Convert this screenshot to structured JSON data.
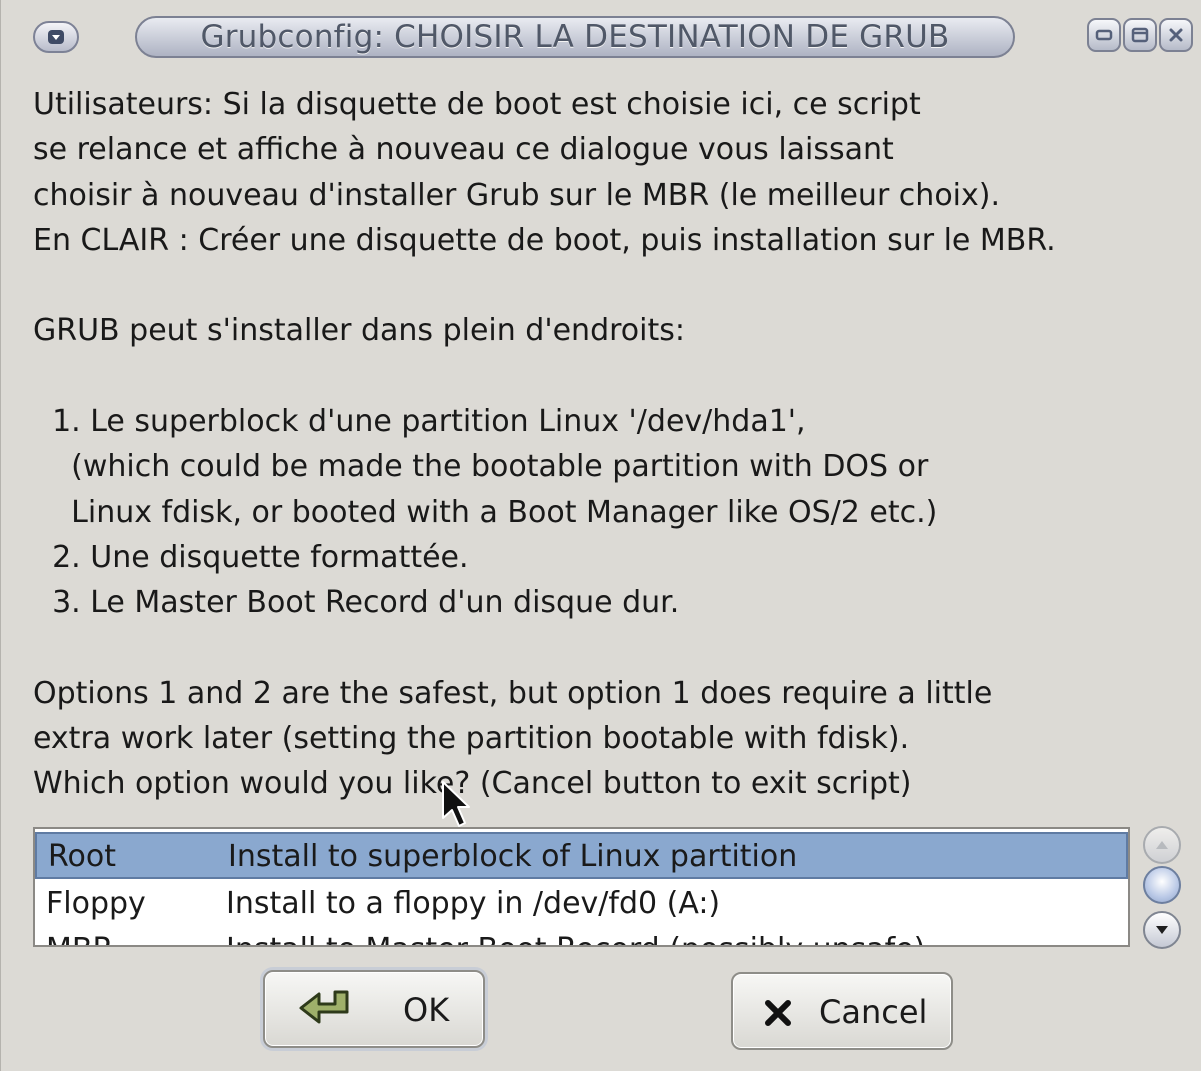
{
  "window": {
    "title": "Grubconfig: CHOISIR LA DESTINATION DE GRUB",
    "menu_icon": "down-arrow-icon",
    "controls": [
      "minimize-icon",
      "maximize-icon",
      "close-icon"
    ]
  },
  "message": "Utilisateurs: Si la disquette de boot est choisie ici, ce script\nse relance et affiche à nouveau ce dialogue vous laissant\nchoisir à nouveau d'installer Grub sur le MBR (le meilleur choix).\nEn CLAIR : Créer une disquette de boot, puis installation sur le MBR.\n\nGRUB peut s'installer dans plein d'endroits:\n\n  1. Le superblock d'une partition Linux '/dev/hda1',\n    (which could be made the bootable partition with DOS or\n    Linux fdisk, or booted with a Boot Manager like OS/2 etc.)\n  2. Une disquette formattée.\n  3. Le Master Boot Record d'un disque dur.\n\nOptions 1 and 2 are the safest, but option 1 does require a little\nextra work later (setting the partition bootable with fdisk).\nWhich option would you like? (Cancel button to exit script)",
  "options": [
    {
      "tag": "Root",
      "desc": "Install to superblock of Linux partition",
      "selected": true
    },
    {
      "tag": "Floppy",
      "desc": "Install to a floppy in /dev/fd0 (A:)",
      "selected": false
    },
    {
      "tag": "MBR",
      "desc": "Install to Master Boot Record (possibly unsafe)",
      "selected": false
    }
  ],
  "buttons": {
    "ok": "OK",
    "cancel": "Cancel"
  },
  "colors": {
    "selection": "#8aa8cf",
    "background": "#dcdad5"
  }
}
